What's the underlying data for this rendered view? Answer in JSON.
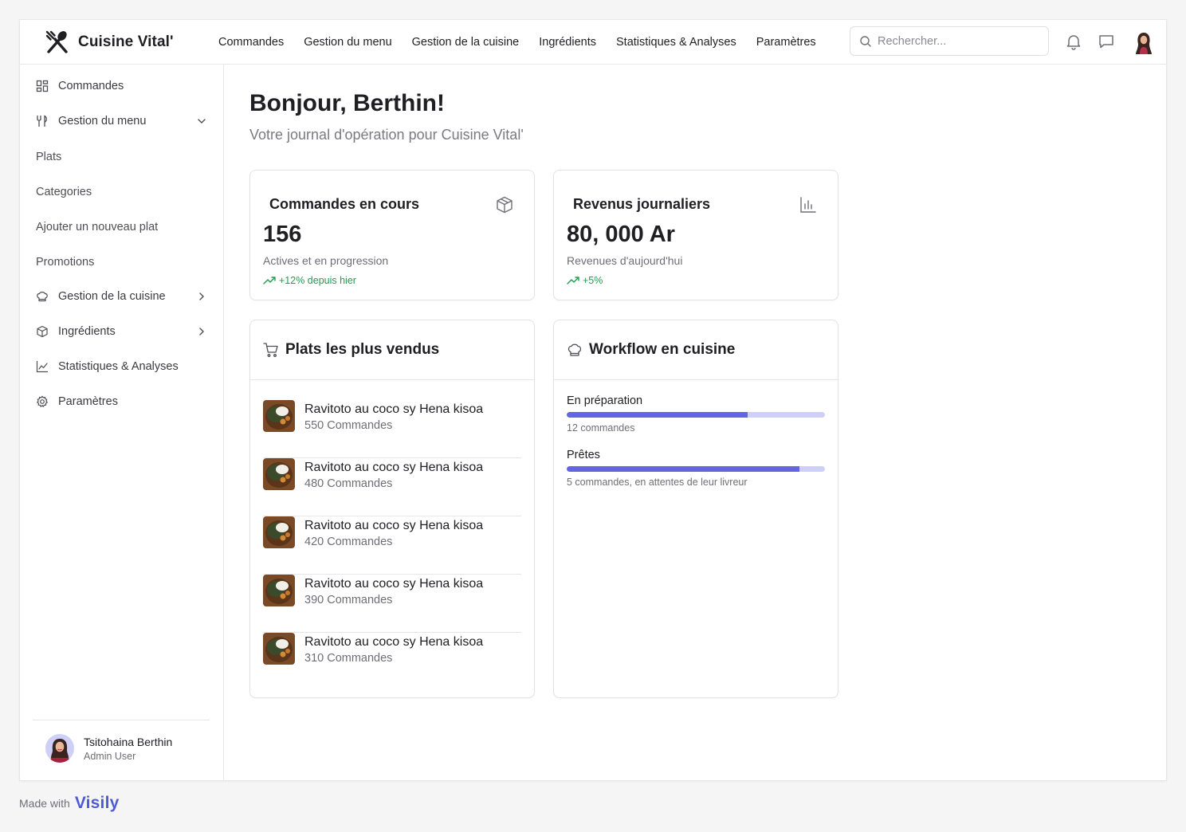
{
  "brand": {
    "name": "Cuisine Vital'"
  },
  "topnav": [
    {
      "label": "Commandes"
    },
    {
      "label": "Gestion du menu"
    },
    {
      "label": "Gestion de la cuisine"
    },
    {
      "label": "Ingrédients"
    },
    {
      "label": "Statistiques & Analyses"
    },
    {
      "label": "Paramètres"
    }
  ],
  "search": {
    "placeholder": "Rechercher...",
    "value": ""
  },
  "sidebar": {
    "items": [
      {
        "label": "Commandes",
        "icon": "grid-icon"
      },
      {
        "label": "Gestion du menu",
        "icon": "utensils-icon",
        "expanded": true
      },
      {
        "label": "Plats"
      },
      {
        "label": "Categories"
      },
      {
        "label": "Ajouter un nouveau plat"
      },
      {
        "label": "Promotions"
      },
      {
        "label": "Gestion de la cuisine",
        "icon": "chef-hat-icon"
      },
      {
        "label": "Ingrédients",
        "icon": "box-icon"
      },
      {
        "label": "Statistiques & Analyses",
        "icon": "line-chart-icon"
      },
      {
        "label": "Paramètres",
        "icon": "gear-icon"
      }
    ]
  },
  "user": {
    "name": "Tsitohaina Berthin",
    "role": "Admin User"
  },
  "main": {
    "greeting": "Bonjour, Berthin!",
    "subtitle": "Votre journal d'opération pour Cuisine Vital'"
  },
  "stats": [
    {
      "title": "Commandes en cours",
      "value": "156",
      "desc": "Actives et en progression",
      "trend": "+12% depuis hier",
      "icon": "package-icon"
    },
    {
      "title": "Revenus journaliers",
      "value": "80, 000 Ar",
      "desc": "Revenues d'aujourd'hui",
      "trend": "+5%",
      "icon": "bar-chart-icon"
    }
  ],
  "top_dishes": {
    "title": "Plats les plus vendus",
    "items": [
      {
        "name": "Ravitoto au coco sy Hena kisoa",
        "count": "550 Commandes"
      },
      {
        "name": "Ravitoto au coco sy Hena kisoa",
        "count": "480 Commandes"
      },
      {
        "name": "Ravitoto au coco sy Hena kisoa",
        "count": "420 Commandes"
      },
      {
        "name": "Ravitoto au coco sy Hena kisoa",
        "count": "390 Commandes"
      },
      {
        "name": "Ravitoto au coco sy Hena kisoa",
        "count": "310 Commandes"
      }
    ]
  },
  "workflow": {
    "title": "Workflow en cuisine",
    "stages": [
      {
        "label": "En préparation",
        "progress": 0.7,
        "note": "12 commandes"
      },
      {
        "label": "Prêtes",
        "progress": 0.9,
        "note": "5 commandes, en attentes de leur livreur"
      }
    ]
  },
  "footer": {
    "text": "Made with",
    "logo": "Visily"
  },
  "colors": {
    "accent": "#6366e0",
    "accent_light": "#cfd0f7",
    "trend_green": "#1f9d4f"
  }
}
